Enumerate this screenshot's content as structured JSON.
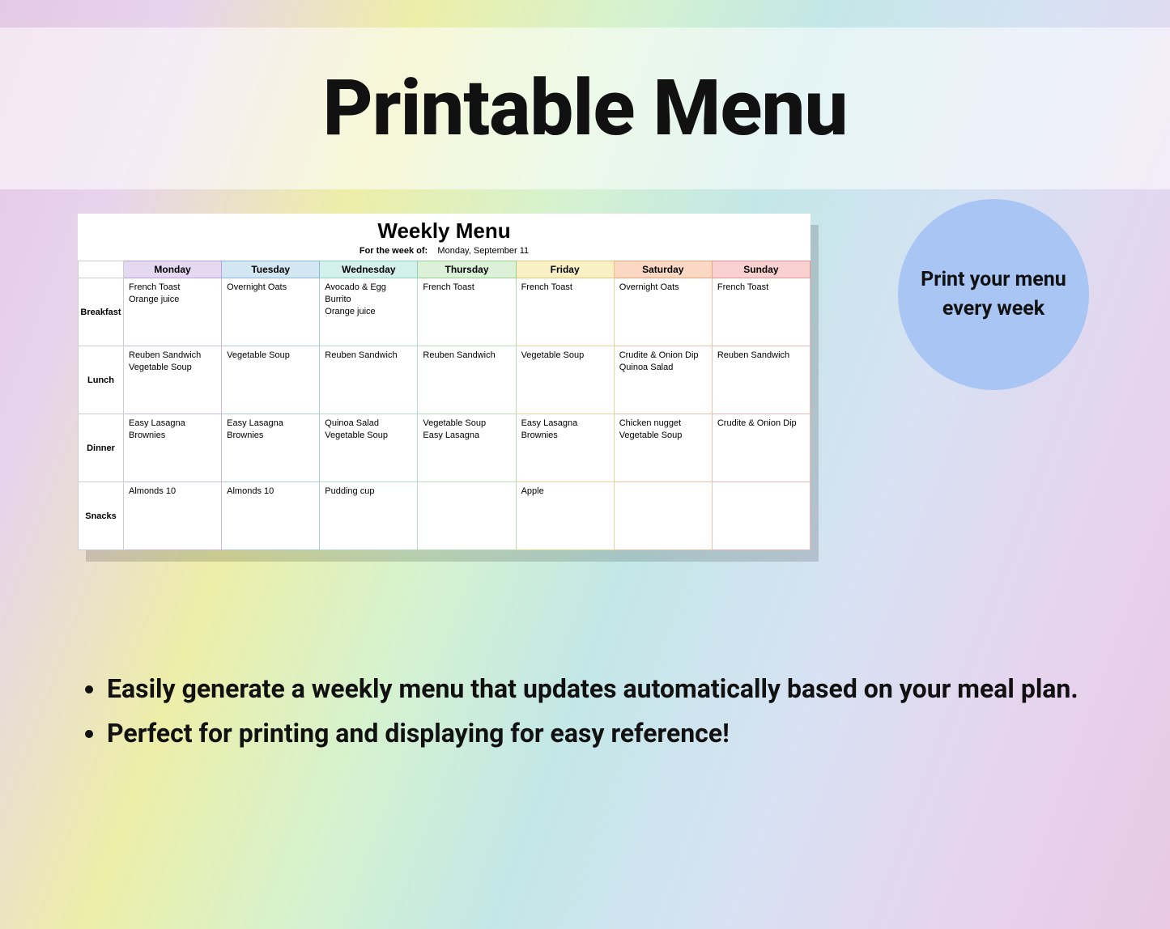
{
  "header": {
    "title": "Printable Menu"
  },
  "callout": {
    "text": "Print your menu every week"
  },
  "sheet": {
    "title": "Weekly Menu",
    "week_label": "For the week of:",
    "week_value": "Monday, September 11",
    "days": [
      "Monday",
      "Tuesday",
      "Wednesday",
      "Thursday",
      "Friday",
      "Saturday",
      "Sunday"
    ],
    "rows": [
      {
        "label": "Breakfast",
        "cells": [
          [
            "French Toast",
            "Orange juice"
          ],
          [
            "Overnight Oats"
          ],
          [
            "Avocado & Egg Burrito",
            "Orange juice"
          ],
          [
            "French Toast"
          ],
          [
            "French Toast"
          ],
          [
            "Overnight Oats"
          ],
          [
            "French Toast"
          ]
        ]
      },
      {
        "label": "Lunch",
        "cells": [
          [
            "Reuben Sandwich",
            "Vegetable Soup"
          ],
          [
            "Vegetable Soup"
          ],
          [
            "Reuben Sandwich"
          ],
          [
            "Reuben Sandwich"
          ],
          [
            "Vegetable Soup"
          ],
          [
            "Crudite & Onion Dip",
            "Quinoa Salad"
          ],
          [
            "Reuben Sandwich"
          ]
        ]
      },
      {
        "label": "Dinner",
        "cells": [
          [
            "Easy Lasagna",
            "Brownies"
          ],
          [
            "Easy Lasagna",
            "Brownies"
          ],
          [
            "Quinoa Salad",
            "Vegetable Soup"
          ],
          [
            "Vegetable Soup",
            "Easy Lasagna"
          ],
          [
            "Easy Lasagna",
            "Brownies"
          ],
          [
            "Chicken nugget",
            "Vegetable Soup"
          ],
          [
            "Crudite & Onion Dip"
          ]
        ]
      },
      {
        "label": "Snacks",
        "cells": [
          [
            "Almonds 10"
          ],
          [
            "Almonds 10"
          ],
          [
            "Pudding cup"
          ],
          [],
          [
            "Apple"
          ],
          [],
          []
        ]
      }
    ]
  },
  "bullets": [
    "Easily generate a weekly menu that updates automatically based on your meal plan.",
    "Perfect for printing and displaying for easy reference!"
  ]
}
